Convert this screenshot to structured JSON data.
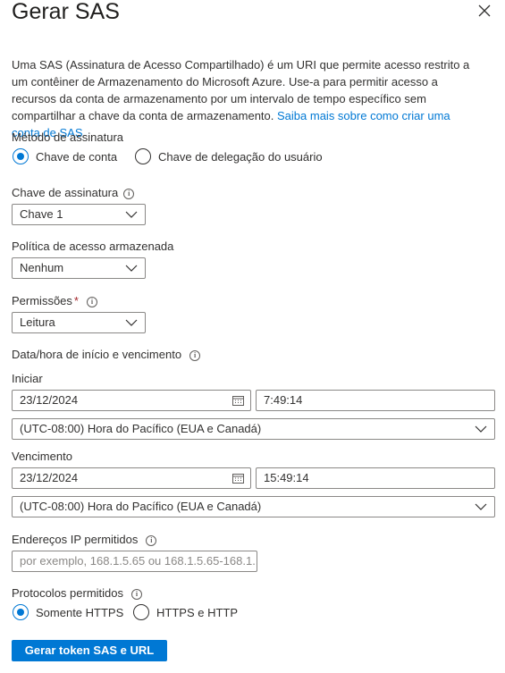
{
  "panel": {
    "title": "Gerar SAS",
    "description": "Uma SAS (Assinatura de Acesso Compartilhado) é um URI que permite acesso restrito a um contêiner de Armazenamento do Microsoft Azure. Use-a para permitir acesso a recursos da conta de armazenamento por um intervalo de tempo específico sem compartilhar a chave da conta de armazenamento.",
    "learn_more_link": "Saiba mais sobre como criar uma conta de SAS"
  },
  "signing_method": {
    "label": "Método de assinatura",
    "options": [
      "Chave de conta",
      "Chave de delegação do usuário"
    ],
    "selected": "Chave de conta"
  },
  "signing_key": {
    "label": "Chave de assinatura",
    "value": "Chave 1"
  },
  "stored_policy": {
    "label": "Política de acesso armazenada",
    "value": "Nenhum"
  },
  "permissions": {
    "label": "Permissões",
    "required_mark": "*",
    "value": "Leitura"
  },
  "datetime": {
    "label": "Data/hora de início e vencimento",
    "start": {
      "label": "Iniciar",
      "date": "23/12/2024",
      "time": "7:49:14",
      "timezone": "(UTC-08:00) Hora do Pacífico (EUA e Canadá)"
    },
    "expiry": {
      "label": "Vencimento",
      "date": "23/12/2024",
      "time": "15:49:14",
      "timezone": "(UTC-08:00) Hora do Pacífico (EUA e Canadá)"
    }
  },
  "allowed_ips": {
    "label": "Endereços IP permitidos",
    "placeholder": "por exemplo, 168.1.5.65 ou 168.1.5.65-168.1..."
  },
  "protocols": {
    "label": "Protocolos permitidos",
    "options": [
      "Somente HTTPS",
      "HTTPS e HTTP"
    ],
    "selected": "Somente HTTPS"
  },
  "generate_button": "Gerar token SAS e URL",
  "colors": {
    "accent": "#0078d4",
    "required": "#a4262c",
    "border": "#8a8886",
    "text": "#323130"
  },
  "icons": [
    "close-icon",
    "info-icon",
    "chevron-down-icon",
    "calendar-icon"
  ]
}
